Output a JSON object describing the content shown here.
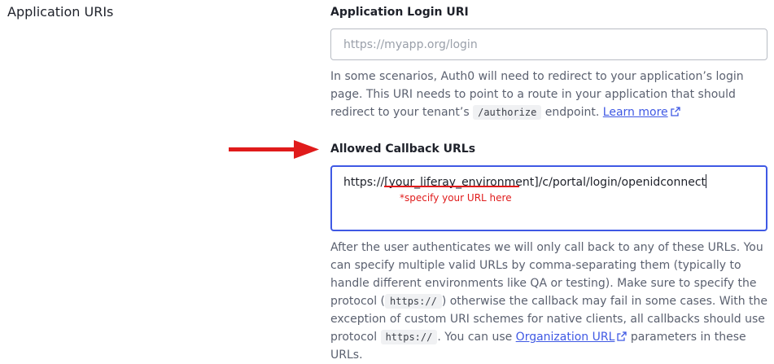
{
  "section": {
    "title": "Application URIs"
  },
  "login_uri": {
    "label": "Application Login URI",
    "placeholder": "https://myapp.org/login",
    "help_before_code": "In some scenarios, Auth0 will need to redirect to your application’s login page. This URI needs to point to a route in your application that should redirect to your tenant’s ",
    "code": "/authorize",
    "help_after_code": " endpoint. ",
    "learn_more": "Learn more"
  },
  "callback_urls": {
    "label": "Allowed Callback URLs",
    "value": "https://[your_liferay_environment]/c/portal/login/openidconnect",
    "annotation": "*specify your URL here",
    "help_part1": "After the user authenticates we will only call back to any of these URLs. You can specify multiple valid URLs by comma-separating them (typically to handle different environments like QA or testing). Make sure to specify the protocol (",
    "code1": "https://",
    "help_part2": ") otherwise the callback may fail in some cases. With the exception of custom URI schemes for native clients, all callbacks should use protocol ",
    "code2": "https://",
    "help_part3": ". You can use ",
    "org_url_link": "Organization URL",
    "help_part4": " parameters in these URLs."
  },
  "colors": {
    "accent": "#3f59e4",
    "annotation": "#e01b1b"
  },
  "icons": {
    "external_link": "external-link-icon",
    "arrow": "red-arrow-icon"
  }
}
